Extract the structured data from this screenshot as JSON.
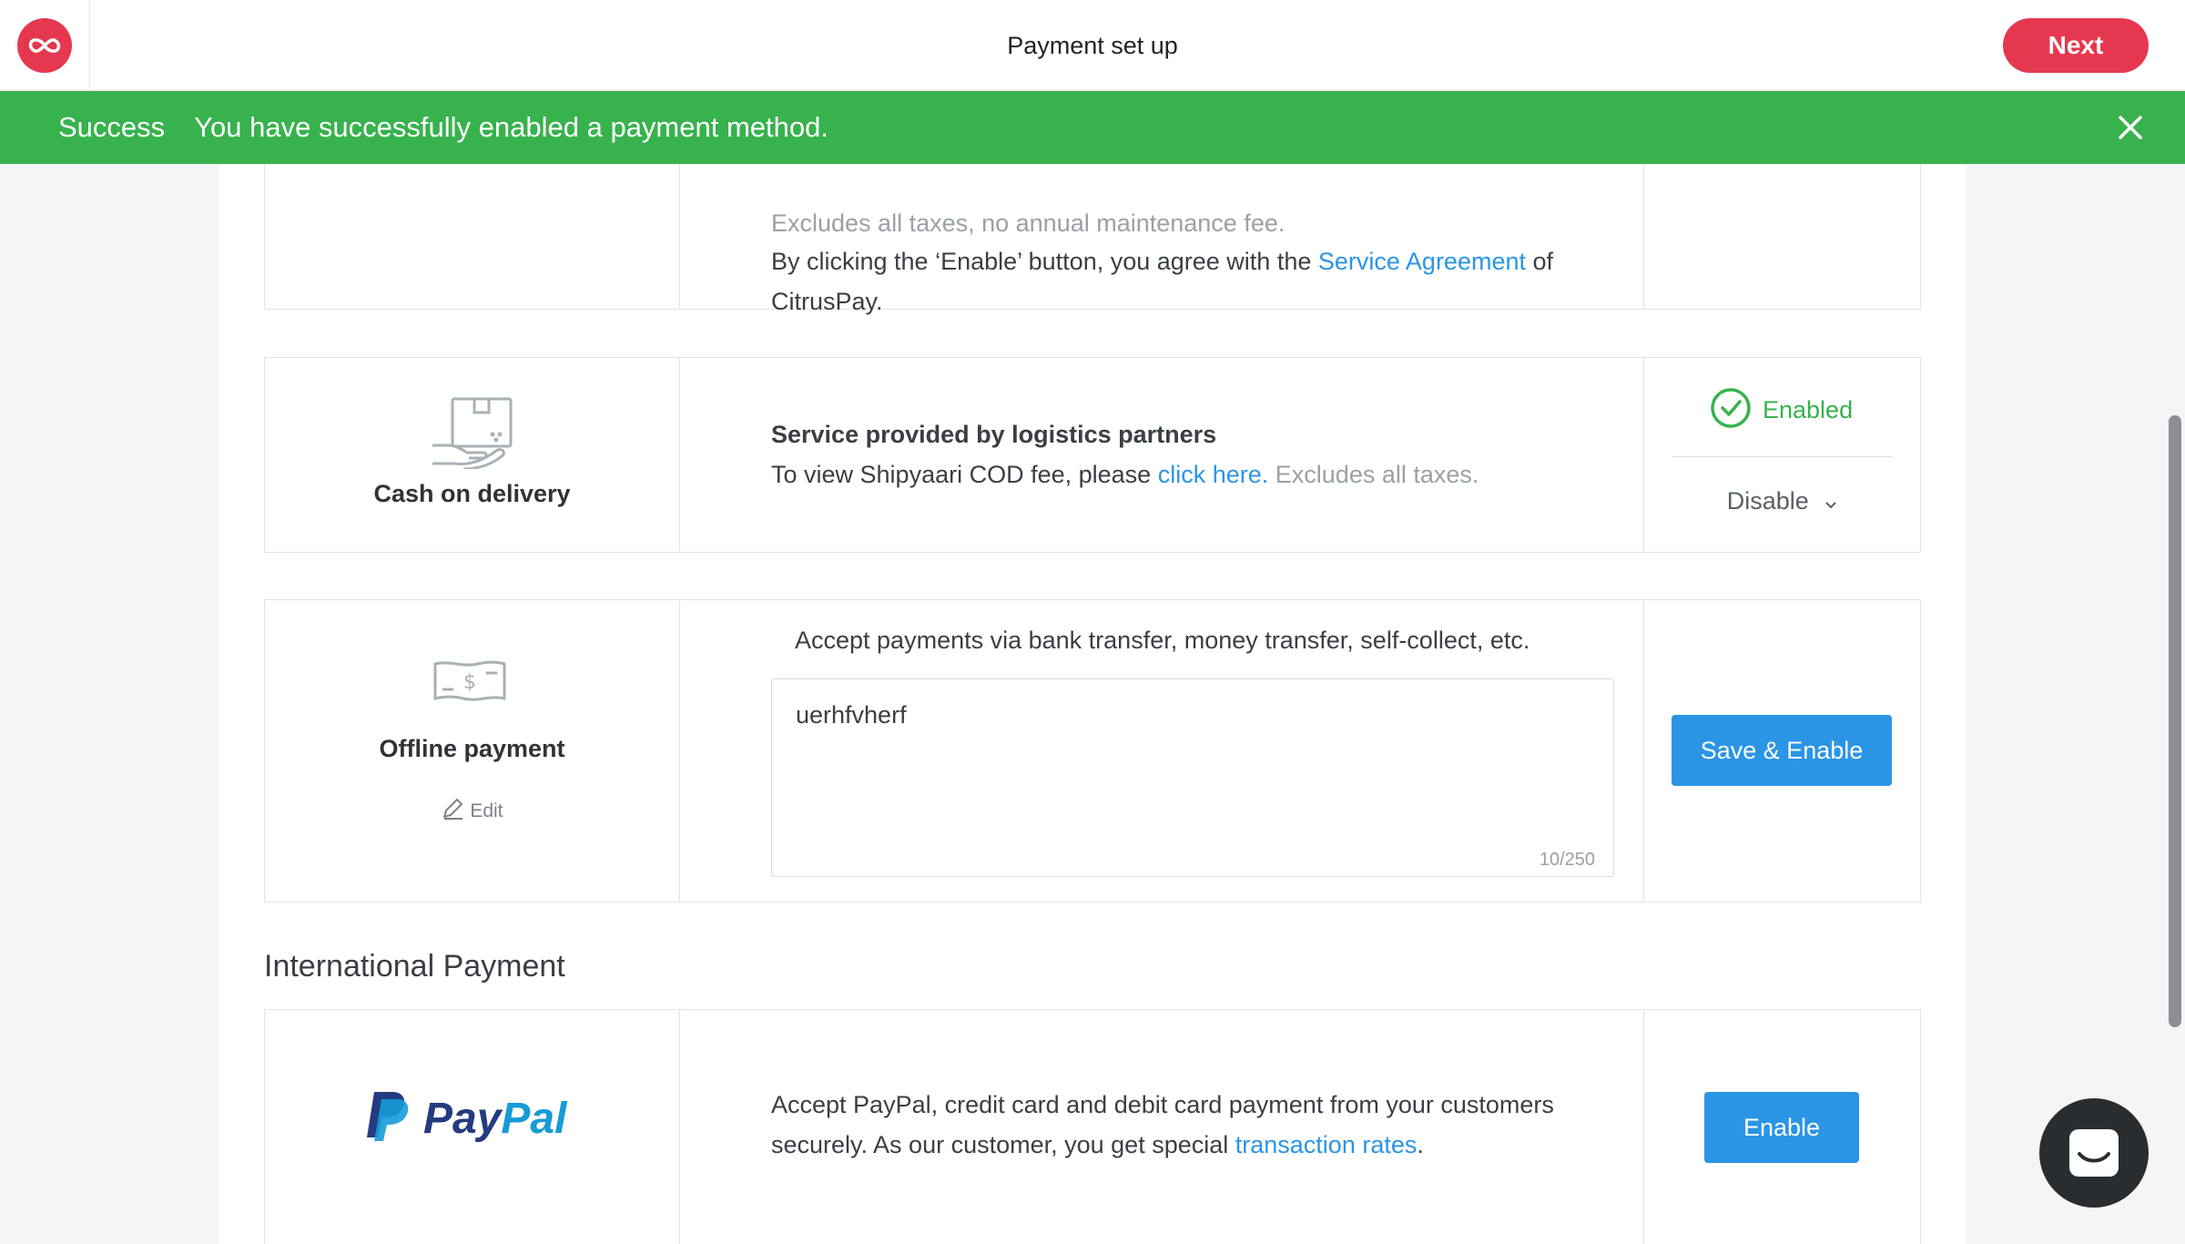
{
  "header": {
    "title": "Payment set up",
    "next_label": "Next"
  },
  "banner": {
    "title": "Success",
    "message": "You have successfully enabled a payment method."
  },
  "citrus": {
    "fee_line": "Excludes all taxes, no annual maintenance fee.",
    "agree_prefix": "By clicking the ‘Enable’ button, you agree with the",
    "agreement_link": "Service Agreement",
    "agree_suffix": "of",
    "agree_end": "CitrusPay."
  },
  "cod": {
    "name": "Cash on delivery",
    "heading": "Service provided by logistics partners",
    "view_prefix": "To view Shipyaari COD fee, please",
    "view_link": "click here.",
    "view_suffix": "Excludes all taxes.",
    "status": "Enabled",
    "disable_label": "Disable"
  },
  "offline": {
    "name": "Offline payment",
    "edit_label": "Edit",
    "description": "Accept payments via bank transfer, money transfer, self-collect, etc.",
    "textarea_value": "uerhfvherf",
    "counter": "10/250",
    "save_label": "Save & Enable"
  },
  "international": {
    "section_title": "International Payment"
  },
  "paypal": {
    "logo_text_dark": "Pay",
    "logo_text_light": "Pal",
    "line1": "Accept PayPal, credit card and debit card payment from your customers",
    "line2_prefix": "securely. As our customer, you get special",
    "rates_link": "transaction rates",
    "line2_suffix": ".",
    "enable_label": "Enable"
  },
  "colors": {
    "brand_red": "#e5384f",
    "success_green": "#37b24d",
    "link_blue": "#2b95e5",
    "paypal_dark": "#253b80",
    "paypal_light": "#179bd7"
  }
}
